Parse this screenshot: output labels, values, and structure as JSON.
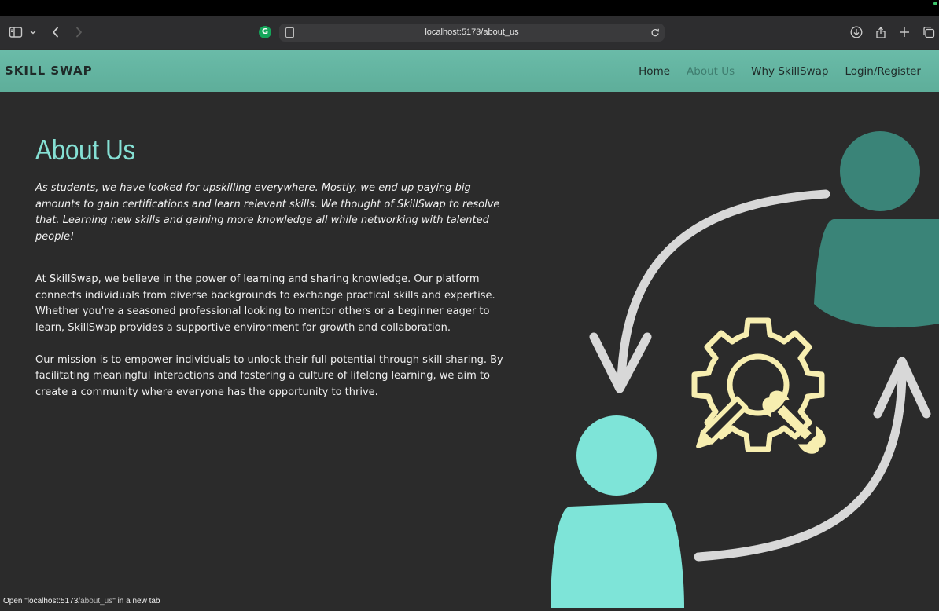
{
  "browser": {
    "url": "localhost:5173/about_us",
    "extension_letter": "G",
    "icons": [
      "sidebar-icon",
      "chevron-down-icon",
      "back-arrow-icon",
      "forward-arrow-icon",
      "page-icon",
      "reload-icon",
      "download-icon",
      "share-icon",
      "plus-icon",
      "tabs-icon"
    ]
  },
  "site": {
    "brand": "SKILL SWAP",
    "nav": [
      "Home",
      "About Us",
      "Why SkillSwap",
      "Login/Register"
    ],
    "active_nav": "About Us"
  },
  "about": {
    "title": "About Us",
    "intro": "As students, we have looked for upskilling everywhere. Mostly, we end up paying big amounts to gain certifications and learn relevant skills. We thought of SkillSwap to resolve that. Learning new skills and gaining more knowledge all while networking with talented people!",
    "paragraph1": "At SkillSwap, we believe in the power of learning and sharing knowledge. Our platform connects individuals from diverse backgrounds to exchange practical skills and expertise. Whether you're a seasoned professional looking to mentor others or a beginner eager to learn, SkillSwap provides a supportive environment for growth and collaboration.",
    "paragraph2": "Our mission is to empower individuals to unlock their full potential through skill sharing. By facilitating meaningful interactions and fostering a culture of lifelong learning, we aim to create a community where everyone has the opportunity to thrive."
  },
  "status": {
    "prefix": "Open \"localhost:5173",
    "path": "/about_us",
    "suffix": "\" in a new tab"
  },
  "colors": {
    "nav_bg": "#62b4a0",
    "page_bg": "#2b2b2b",
    "title": "#85e0d4",
    "person_dark": "#3a8478",
    "person_light": "#7ee4d8",
    "gear": "#f7eeb0",
    "arrow": "#d8d8d8"
  }
}
